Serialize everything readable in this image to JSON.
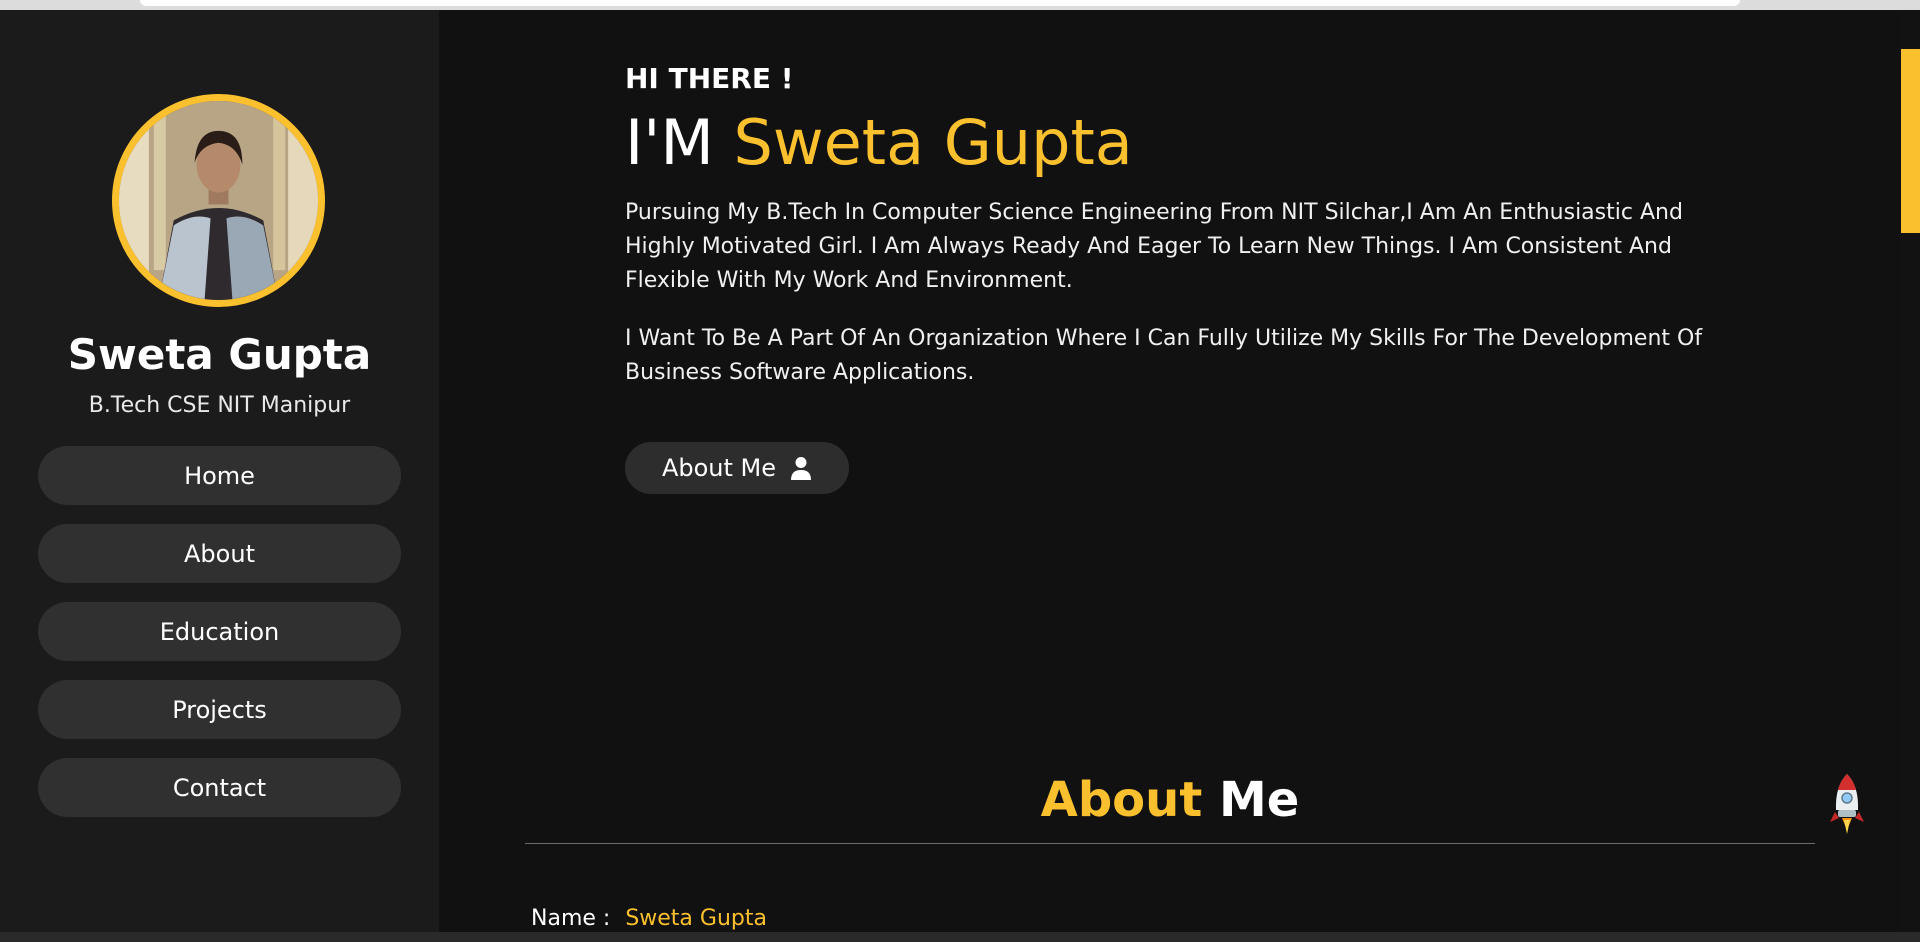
{
  "sidebar": {
    "name": "Sweta Gupta",
    "subtitle": "B.Tech CSE NIT Manipur",
    "nav": [
      "Home",
      "About",
      "Education",
      "Projects",
      "Contact"
    ]
  },
  "hero": {
    "greeting": "HI THERE !",
    "intro_prefix": "I'M",
    "intro_name": "Sweta Gupta",
    "paragraphs": [
      "Pursuing My B.Tech In Computer Science Engineering From NIT Silchar,I Am An Enthusiastic And Highly Motivated Girl. I Am Always Ready And Eager To Learn New Things. I Am Consistent And Flexible With My Work And Environment.",
      "I Want To Be A Part Of An Organization Where I Can Fully Utilize My Skills For The Development Of Business Software Applications."
    ],
    "button_label": "About Me",
    "button_icon": "user-icon"
  },
  "about": {
    "title_highlight": "About",
    "title_rest": "Me",
    "name_label": "Name :",
    "name_value": "Sweta Gupta"
  },
  "colors": {
    "accent": "#fbc02d",
    "background": "#111111",
    "sidebar": "#1b1b1b",
    "button": "#303030"
  },
  "icons": {
    "scroll_top": "rocket-icon"
  }
}
